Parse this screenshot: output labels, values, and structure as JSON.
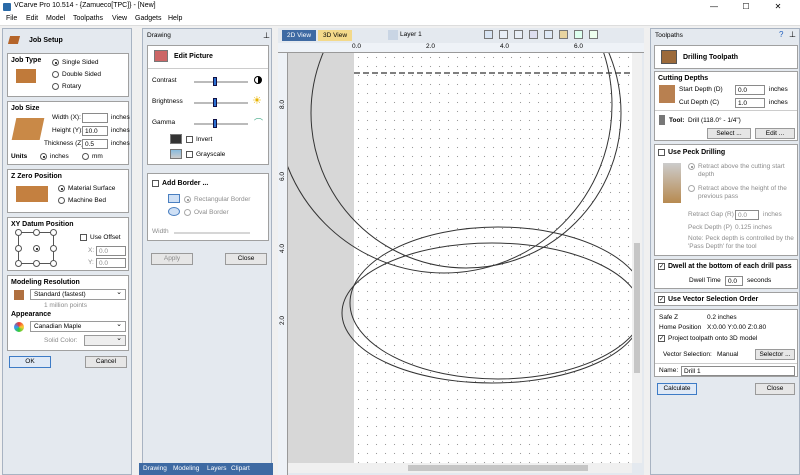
{
  "window": {
    "title": "VCarve Pro 10.514 - {Zamueco[TPC]} - [New]",
    "min": "—",
    "max": "☐",
    "close": "✕"
  },
  "menu": [
    "File",
    "Edit",
    "Model",
    "Toolpaths",
    "View",
    "Gadgets",
    "Help"
  ],
  "job": {
    "heading": "Job Setup",
    "job_type_title": "Job Type",
    "job_types": [
      "Single Sided",
      "Double Sided",
      "Rotary"
    ],
    "job_size_title": "Job Size",
    "width_label": "Width (X):",
    "width_value": "",
    "height_label": "Height (Y):",
    "height_value": "10.0",
    "thickness_label": "Thickness (Z):",
    "thickness_value": "0.5",
    "unit": "inches",
    "units_label": "Units",
    "units": [
      "inches",
      "mm"
    ],
    "zzero_title": "Z Zero Position",
    "zzero_options": [
      "Material Surface",
      "Machine Bed"
    ],
    "xy_title": "XY Datum Position",
    "use_offset": "Use Offset",
    "x_label": "X:",
    "x_value": "0.0",
    "y_label": "Y:",
    "y_value": "0.0",
    "res_title": "Modeling Resolution",
    "res_value": "Standard (fastest)",
    "res_note": "1 million points",
    "appearance_title": "Appearance",
    "appearance_value": "Canadian Maple",
    "solid_color_label": "Solid Color:",
    "ok": "OK",
    "cancel": "Cancel"
  },
  "drawing": {
    "panel_title": "Drawing",
    "heading": "Edit Picture",
    "contrast": "Contrast",
    "brightness": "Brightness",
    "gamma": "Gamma",
    "contrast_level": 0.38,
    "brightness_level": 0.38,
    "gamma_level": 0.38,
    "invert": "Invert",
    "grayscale": "Grayscale",
    "add_border": "Add Border ...",
    "rect_border": "Rectangular Border",
    "oval_border": "Oval Border",
    "width_label": "Width",
    "apply": "Apply",
    "close": "Close",
    "tabs": [
      "Drawing",
      "Modeling",
      "Layers",
      "Clipart"
    ]
  },
  "view": {
    "tabs": [
      "2D View",
      "3D View"
    ],
    "layer": "Layer 1",
    "ruler_top": [
      "0.0",
      "2.0",
      "4.0",
      "6.0"
    ],
    "ruler_left": [
      "8.0",
      "6.0",
      "4.0",
      "2.0"
    ]
  },
  "toolpaths": {
    "panel_title": "Toolpaths",
    "heading": "Drilling Toolpath",
    "cutting_depths": "Cutting Depths",
    "start_depth_label": "Start Depth (D)",
    "start_depth_value": "0.0",
    "cut_depth_label": "Cut Depth (C)",
    "cut_depth_value": "1.0",
    "unit": "inches",
    "tool_label": "Tool:",
    "tool_value": "Drill (118.0° - 1/4\")",
    "select": "Select ...",
    "edit": "Edit ...",
    "peck": "Use Peck Drilling",
    "retract_above_start": "Retract above the cutting start depth",
    "retract_above_prev": "Retract above the height of the previous pass",
    "retract_gap_label": "Retract Gap (R)",
    "retract_gap_value": "0.0",
    "peck_depth_label": "Peck Depth (P)",
    "peck_depth_value": "0.125 inches",
    "note": "Note: Peck depth is controlled by the 'Pass Depth' for the tool",
    "dwell": "Dwell at the bottom of each drill pass",
    "dwell_time_label": "Dwell Time",
    "dwell_time_value": "0.0",
    "seconds": "seconds",
    "vector_sel": "Use Vector Selection Order",
    "safe_z_label": "Safe Z",
    "safe_z_value": "0.2 inches",
    "home_label": "Home Position",
    "home_value": "X:0.00 Y:0.00 Z:0.80",
    "project": "Project toolpath onto 3D model",
    "vector_selection_label": "Vector Selection:",
    "vector_selection_value": "Manual",
    "selector": "Selector ...",
    "name_label": "Name:",
    "name_value": "Drill 1",
    "calculate": "Calculate",
    "close": "Close"
  }
}
